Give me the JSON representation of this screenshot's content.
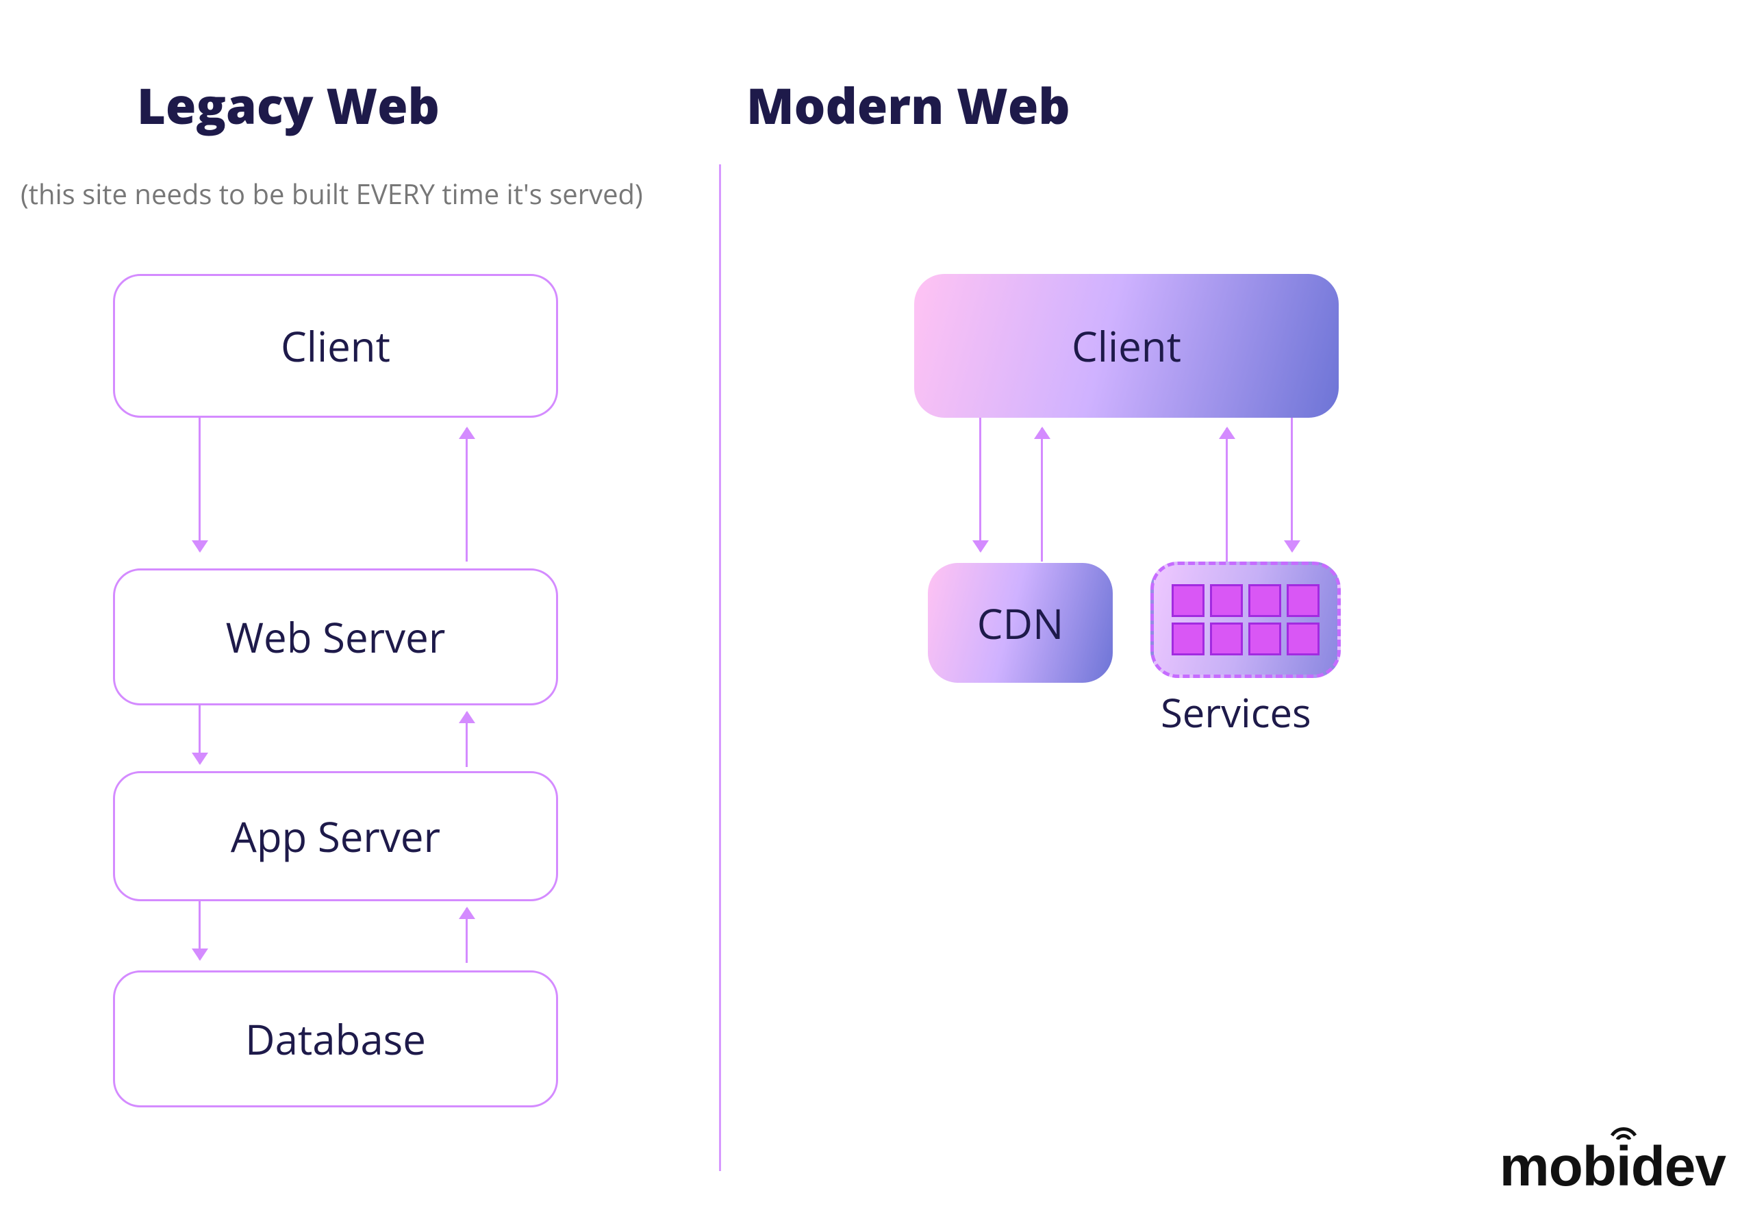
{
  "legacy": {
    "title": "Legacy Web",
    "subtitle": "(this site needs to be built EVERY time it's served)",
    "boxes": {
      "client": "Client",
      "web_server": "Web Server",
      "app_server": "App Server",
      "database": "Database"
    }
  },
  "modern": {
    "title": "Modern Web",
    "boxes": {
      "client": "Client",
      "cdn": "CDN",
      "services": "Services"
    }
  },
  "brand": {
    "name": "mobidev"
  },
  "colors": {
    "accent": "#d48bff",
    "text": "#1e1a4a",
    "gradient_start": "#ffc3f3",
    "gradient_end": "#6d74d6"
  }
}
